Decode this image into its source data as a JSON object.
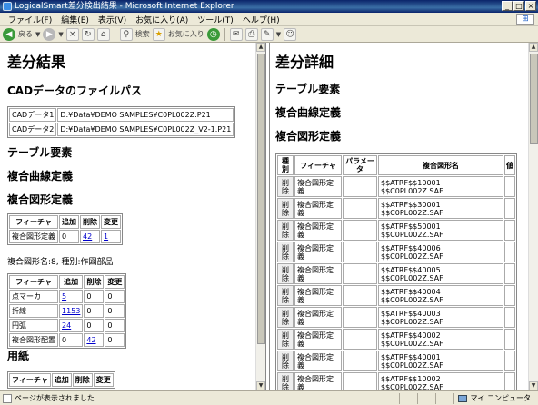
{
  "window": {
    "title": "LogicalSmart差分検出結果 - Microsoft Internet Explorer",
    "btn_min": "_",
    "btn_max": "□",
    "btn_close": "×"
  },
  "menu": {
    "file": "ファイル(F)",
    "edit": "編集(E)",
    "view": "表示(V)",
    "favorites": "お気に入り(A)",
    "tools": "ツール(T)",
    "help": "ヘルプ(H)"
  },
  "toolbar": {
    "back": "戻る",
    "search": "検索",
    "favorites": "お気に入り"
  },
  "left": {
    "title": "差分結果",
    "cad_heading": "CADデータのファイルパス",
    "cad_rows": [
      {
        "label": "CADデータ1",
        "path": "D:¥Data¥DEMO SAMPLES¥C0PL002Z.P21"
      },
      {
        "label": "CADデータ2",
        "path": "D:¥Data¥DEMO SAMPLES¥C0PL002Z_V2-1.P21"
      }
    ],
    "table_heading": "テーブル要素",
    "curve_heading": "複合曲線定義",
    "shape_heading": "複合図形定義",
    "shape_table": {
      "headers": [
        "フィーチャ",
        "追加",
        "削除",
        "変更"
      ],
      "rows": [
        [
          "複合図形定義",
          "0",
          "42",
          "1"
        ]
      ]
    },
    "shape_name_line": "複合図形名:8, 種別:作図部品",
    "feature_table": {
      "headers": [
        "フィーチャ",
        "追加",
        "削除",
        "変更"
      ],
      "rows": [
        [
          "点マーカ",
          "5",
          "0",
          "0"
        ],
        [
          "折線",
          "1153",
          "0",
          "0"
        ],
        [
          "円弧",
          "24",
          "0",
          "0"
        ],
        [
          "複合図形配置",
          "0",
          "42",
          "0"
        ]
      ]
    },
    "paper_heading": "用紙",
    "paper_table": {
      "headers": [
        "フィーチャ",
        "追加",
        "削除",
        "変更"
      ]
    }
  },
  "right": {
    "title": "差分詳細",
    "table_heading": "テーブル要素",
    "curve_heading": "複合曲線定義",
    "shape_heading": "複合図形定義",
    "detail": {
      "headers": [
        "種別",
        "フィーチャ",
        "パラメータ",
        "複合図形名",
        "値"
      ],
      "rows": [
        {
          "kind": "削除",
          "feature": "複合図形定義",
          "line1": "$$ATRF$$10001",
          "line2": "$$C0PL002Z.SAF"
        },
        {
          "kind": "削除",
          "feature": "複合図形定義",
          "line1": "$$ATRF$$30001",
          "line2": "$$C0PL002Z.SAF"
        },
        {
          "kind": "削除",
          "feature": "複合図形定義",
          "line1": "$$ATRF$$50001",
          "line2": "$$C0PL002Z.SAF"
        },
        {
          "kind": "削除",
          "feature": "複合図形定義",
          "line1": "$$ATRF$$40006",
          "line2": "$$C0PL002Z.SAF"
        },
        {
          "kind": "削除",
          "feature": "複合図形定義",
          "line1": "$$ATRF$$40005",
          "line2": "$$C0PL002Z.SAF"
        },
        {
          "kind": "削除",
          "feature": "複合図形定義",
          "line1": "$$ATRF$$40004",
          "line2": "$$C0PL002Z.SAF"
        },
        {
          "kind": "削除",
          "feature": "複合図形定義",
          "line1": "$$ATRF$$40003",
          "line2": "$$C0PL002Z.SAF"
        },
        {
          "kind": "削除",
          "feature": "複合図形定義",
          "line1": "$$ATRF$$40002",
          "line2": "$$C0PL002Z.SAF"
        },
        {
          "kind": "削除",
          "feature": "複合図形定義",
          "line1": "$$ATRF$$40001",
          "line2": "$$C0PL002Z.SAF"
        },
        {
          "kind": "削除",
          "feature": "複合図形定義",
          "line1": "$$ATRF$$10002",
          "line2": "$$C0PL002Z.SAF"
        }
      ]
    }
  },
  "status": {
    "text": "ページが表示されました",
    "zone": "マイ コンピュータ"
  }
}
